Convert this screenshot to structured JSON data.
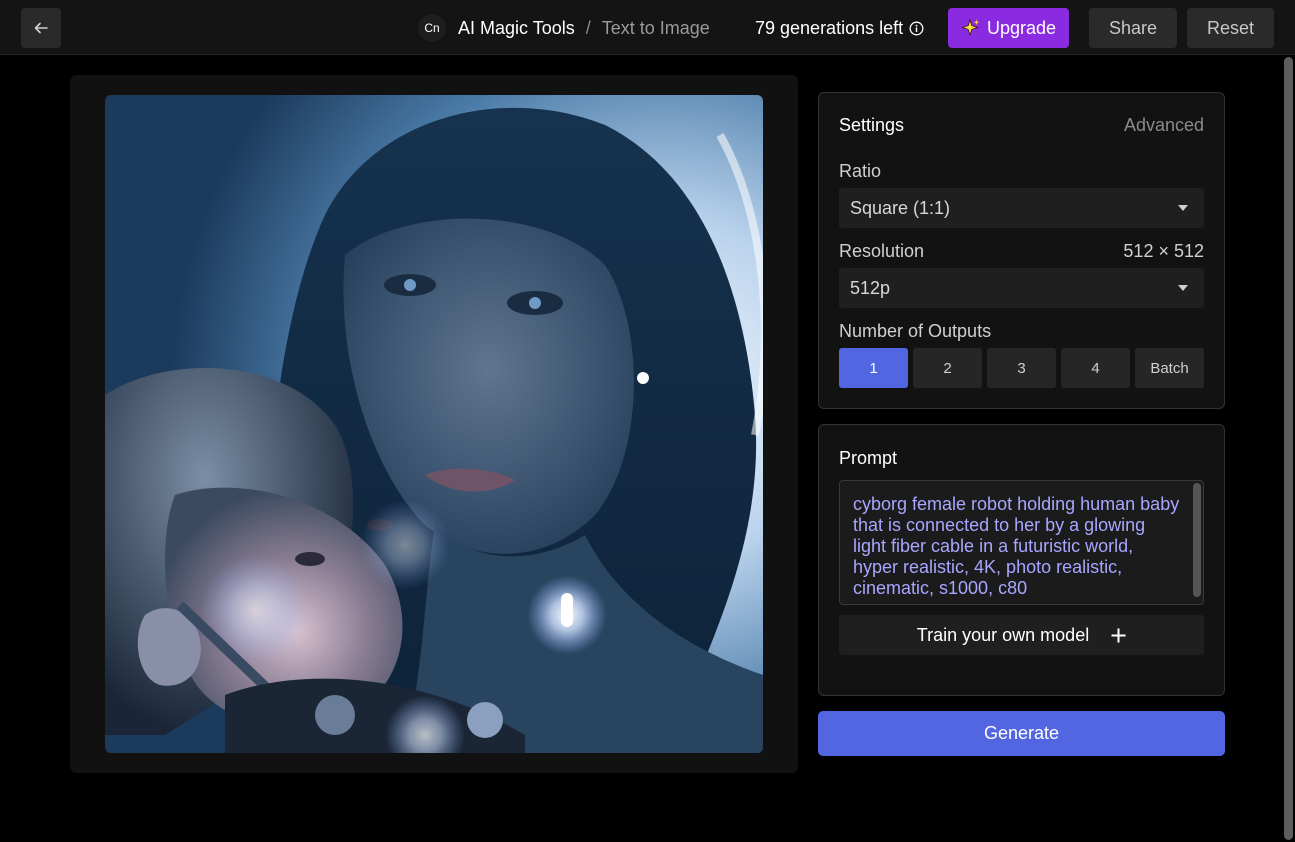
{
  "header": {
    "app_logo": "Cn",
    "breadcrumb_main": "AI Magic Tools",
    "breadcrumb_separator": "/",
    "breadcrumb_current": "Text to Image",
    "generations_left": "79 generations left",
    "upgrade_label": "Upgrade",
    "share_label": "Share",
    "reset_label": "Reset",
    "icons": [
      "arrow-left-icon",
      "info-icon",
      "sparkle-icon"
    ],
    "upgrade_color": "#8a2be2"
  },
  "settings": {
    "title": "Settings",
    "advanced_label": "Advanced",
    "ratio_label": "Ratio",
    "ratio_value": "Square (1:1)",
    "resolution_label": "Resolution",
    "resolution_dims": "512 × 512",
    "resolution_value": "512p",
    "outputs_label": "Number of Outputs",
    "outputs": [
      "1",
      "2",
      "3",
      "4",
      "Batch"
    ],
    "selected_output": "1",
    "accent_color": "#5166e0"
  },
  "prompt": {
    "title": "Prompt",
    "text": "cyborg female robot holding human baby that is connected to her by a glowing light fiber cable in a futuristic world, hyper realistic, 4K, photo realistic, cinematic, s1000, c80",
    "train_label": "Train your own model"
  },
  "generate_label": "Generate"
}
